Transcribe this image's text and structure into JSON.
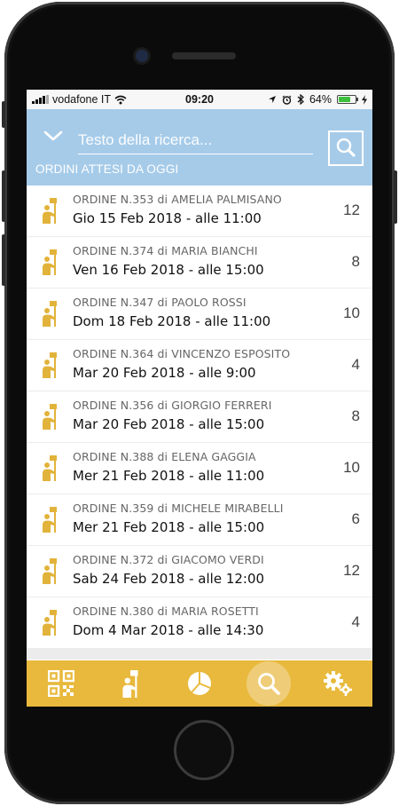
{
  "status_bar": {
    "carrier": "vodafone IT",
    "time": "09:20",
    "battery": "64%",
    "battery_level": 0.64,
    "battery_color": "#3cbf3c",
    "icons": [
      "signal-icon",
      "wifi-icon",
      "location-icon",
      "alarm-icon",
      "bluetooth-icon",
      "battery-icon",
      "charging-icon"
    ]
  },
  "search": {
    "placeholder": "Testo della ricerca...",
    "value": "",
    "section_title": "ORDINI ATTESI DA OGGI"
  },
  "colors": {
    "header_bg": "#a6cbe9",
    "accent": "#e8b93c",
    "icon": "#e2b33a"
  },
  "orders": [
    {
      "title": "ORDINE N.353 di AMELIA PALMISANO",
      "date": "Gio 15 Feb 2018 - alle 11:00",
      "qty": "12"
    },
    {
      "title": "ORDINE N.374 di MARIA BIANCHI",
      "date": "Ven 16 Feb 2018 - alle 15:00",
      "qty": "8"
    },
    {
      "title": "ORDINE N.347 di PAOLO ROSSI",
      "date": "Dom 18 Feb 2018 - alle 11:00",
      "qty": "10"
    },
    {
      "title": "ORDINE N.364 di VINCENZO ESPOSITO",
      "date": "Mar 20 Feb 2018 - alle 9:00",
      "qty": "4"
    },
    {
      "title": "ORDINE N.356 di GIORGIO FERRERI",
      "date": "Mar 20 Feb 2018 - alle 15:00",
      "qty": "8"
    },
    {
      "title": "ORDINE N.388 di ELENA GAGGIA",
      "date": "Mer 21 Feb 2018 - alle 11:00",
      "qty": "10"
    },
    {
      "title": "ORDINE N.359 di MICHELE MIRABELLI",
      "date": "Mer 21 Feb 2018 - alle 15:00",
      "qty": "6"
    },
    {
      "title": "ORDINE N.372 di GIACOMO VERDI",
      "date": "Sab 24 Feb 2018 - alle 12:00",
      "qty": "12"
    },
    {
      "title": "ORDINE N.380 di MARIA ROSETTI",
      "date": "Dom 4 Mar 2018 - alle 14:30",
      "qty": "4"
    }
  ],
  "tabbar": {
    "active": "search",
    "tabs": [
      "qr-code-icon",
      "delivery-person-icon",
      "pie-chart-icon",
      "search-icon",
      "settings-icon"
    ]
  }
}
